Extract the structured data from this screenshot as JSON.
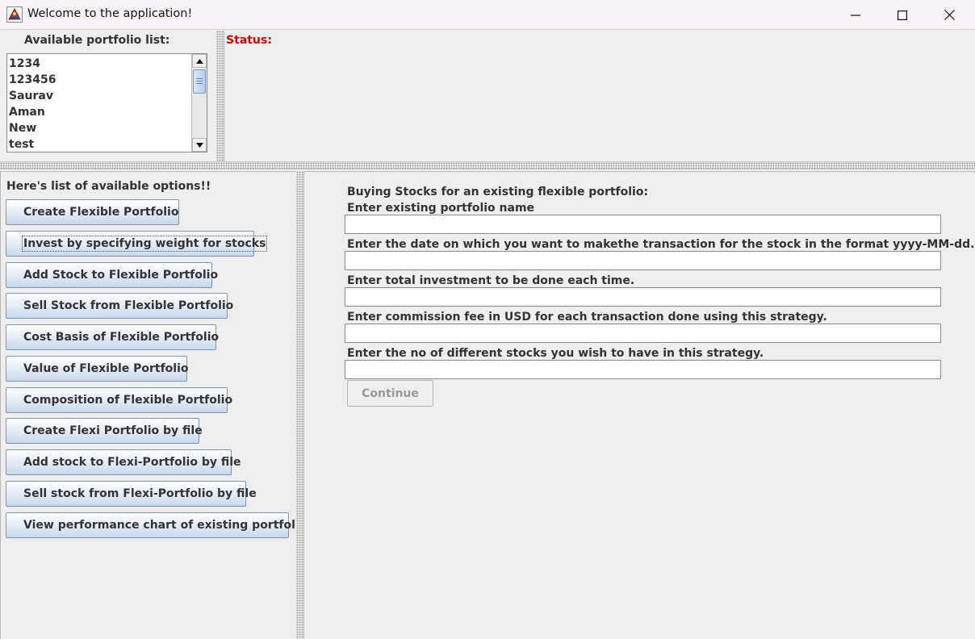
{
  "window": {
    "title": "Welcome to the application!",
    "icon": "java-app-icon",
    "controls": [
      "minimize-icon",
      "maximize-icon",
      "close-icon"
    ]
  },
  "portfolio_list": {
    "label": "Available portfolio list:",
    "items": [
      "1234",
      "123456",
      "Saurav",
      "Aman",
      "New",
      "test"
    ]
  },
  "status": {
    "label": "Status:",
    "color": "#e00000"
  },
  "options": {
    "label": "Here's list of available options!!",
    "buttons": [
      "Create Flexible Portfolio",
      "Invest by specifying weight for stocks",
      "Add Stock to Flexible Portfolio",
      "Sell Stock from Flexible Portfolio",
      "Cost Basis of Flexible Portfolio",
      "Value of Flexible Portfolio",
      "Composition of Flexible Portfolio",
      "Create Flexi Portfolio by file",
      "Add stock to Flexi-Portfolio by file",
      "Sell stock from Flexi-Portfolio by file",
      "View performance chart of existing portfolio"
    ]
  },
  "form": {
    "heading": "Buying Stocks for an existing flexible portfolio:",
    "fields": [
      {
        "label": "Enter existing portfolio name",
        "value": ""
      },
      {
        "label": "Enter the date on which you want to makethe transaction for the stock in the format yyyy-MM-dd.",
        "value": ""
      },
      {
        "label": "Enter total investment to be done each time.",
        "value": ""
      },
      {
        "label": "Enter commission fee in USD for each transaction done using this strategy.",
        "value": ""
      },
      {
        "label": "Enter the no of different stocks you wish to have in this strategy.",
        "value": ""
      }
    ],
    "continue_label": "Continue"
  }
}
